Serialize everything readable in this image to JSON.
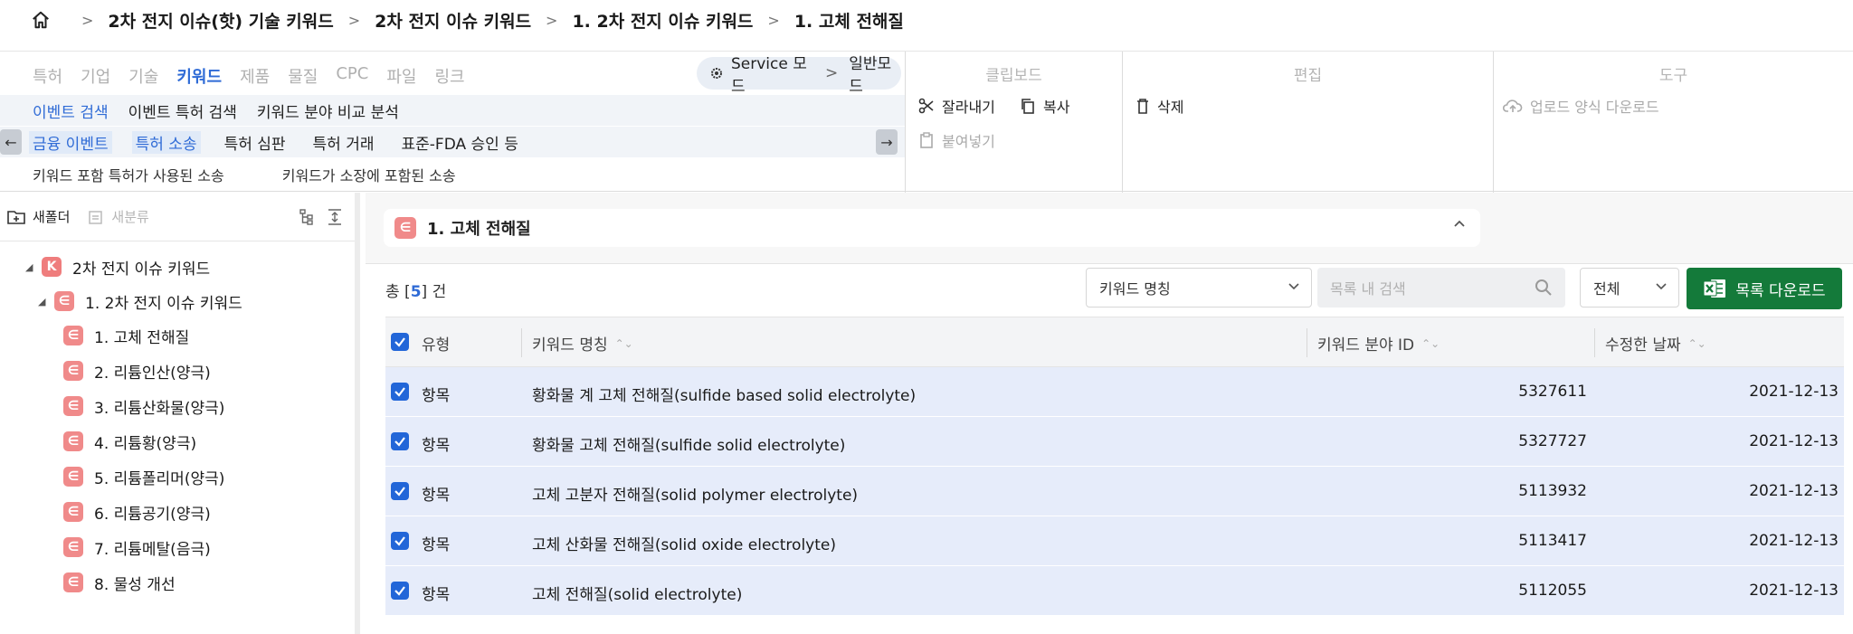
{
  "breadcrumb": [
    "2차 전지 이슈(핫) 기술 키워드",
    "2차 전지 이슈 키워드",
    "1. 2차 전지 이슈 키워드",
    "1. 고체 전해질"
  ],
  "ribbon": {
    "main_tabs": [
      "특허",
      "기업",
      "기술",
      "키워드",
      "제품",
      "물질",
      "CPC",
      "파일",
      "링크"
    ],
    "active_tab": "키워드",
    "mode": {
      "service": "Service 모드",
      "normal": "일반모드"
    },
    "row1": [
      "이벤트 검색",
      "이벤트 특허 검색",
      "키워드 분야 비교 분석"
    ],
    "row2": [
      "금융 이벤트",
      "특허 소송",
      "특허 심판",
      "특허 거래",
      "표준-FDA 승인 등"
    ],
    "row3": [
      "키워드 포함 특허가 사용된 소송",
      "키워드가 소장에 포함된 소송"
    ],
    "clipboard": {
      "title": "클립보드",
      "cut": "잘라내기",
      "copy": "복사",
      "paste": "붙여넣기"
    },
    "edit": {
      "title": "편집",
      "delete": "삭제"
    },
    "tools": {
      "title": "도구",
      "upload": "업로드 양식 다운로드"
    }
  },
  "sidebar": {
    "new_folder": "새폴더",
    "new_category": "새분류",
    "root": {
      "badge": "K",
      "label": "2차 전지 이슈 키워드"
    },
    "level1": {
      "label": "1. 2차 전지 이슈 키워드"
    },
    "items": [
      "1. 고체 전해질",
      "2. 리튬인산(양극)",
      "3. 리튬산화물(양극)",
      "4. 리튬황(양극)",
      "5. 리튬폴리머(양극)",
      "6. 리튬공기(양극)",
      "7. 리튬메탈(음극)",
      "8. 물성 개선"
    ]
  },
  "main": {
    "title": "1. 고체 전해질",
    "count_prefix": "총 [",
    "count": "5",
    "count_suffix": "] 건",
    "field_select": "키워드 명칭",
    "search_placeholder": "목록 내 검색",
    "scope_select": "전체",
    "download": "목록 다운로드",
    "columns": [
      "유형",
      "키워드 명칭",
      "키워드 분야 ID",
      "수정한 날짜"
    ],
    "rows": [
      {
        "type": "항목",
        "name": "황화물 계 고체 전해질(sulfide based solid electrolyte)",
        "id": "5327611",
        "date": "2021-12-13"
      },
      {
        "type": "항목",
        "name": "황화물 고체 전해질(sulfide solid electrolyte)",
        "id": "5327727",
        "date": "2021-12-13"
      },
      {
        "type": "항목",
        "name": "고체 고분자 전해질(solid polymer electrolyte)",
        "id": "5113932",
        "date": "2021-12-13"
      },
      {
        "type": "항목",
        "name": "고체 산화물 전해질(solid oxide electrolyte)",
        "id": "5113417",
        "date": "2021-12-13"
      },
      {
        "type": "항목",
        "name": "고체 전해질(solid electrolyte)",
        "id": "5112055",
        "date": "2021-12-13"
      }
    ]
  },
  "colors": {
    "accent": "#2f6bd6",
    "checkbox": "#2266d8",
    "row_bg": "#e6ecfa",
    "download_bg": "#147a3a",
    "badge": "#f08a8a"
  }
}
